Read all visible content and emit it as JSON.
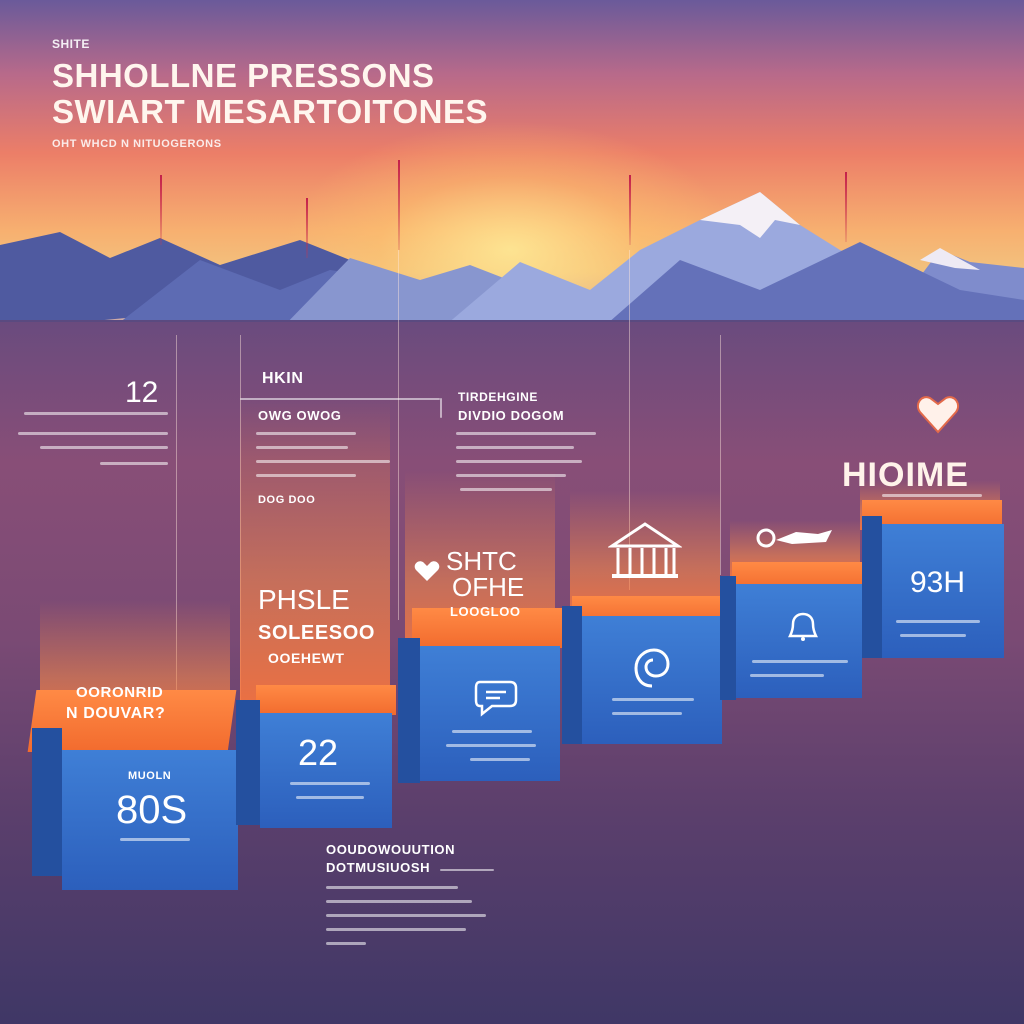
{
  "header": {
    "top_label": "SHITE",
    "title_line1": "SHHOLLNE PRESSONS",
    "title_line2": "SWIART MESARTOITONES",
    "tagline": "OHT WHCD N NITUOGERONS"
  },
  "columns": [
    {
      "id": "col1",
      "label": "12",
      "overlay_text": "OORONRID",
      "overlay_text2": "N DOUVAR?",
      "value_small": "MUOLN",
      "value": "80S"
    },
    {
      "id": "col2",
      "label": "HKIN",
      "heading": "OWG OWOG",
      "small": "DOG DOO",
      "card_line1": "PHSLE",
      "card_line2": "SOLEESOO",
      "card_line3": "OOEHEWT",
      "value": "22"
    },
    {
      "id": "col3",
      "heading1": "TIRDEHGINE",
      "heading2": "DIVDIO DOGOM",
      "card_line1": "SHTC",
      "card_line2": "OFHE",
      "card_line3": "LOOGLOO"
    },
    {
      "id": "col4"
    },
    {
      "id": "col5"
    },
    {
      "id": "col6",
      "head_word": "HIOIME",
      "value": "93H"
    }
  ],
  "footer": {
    "heading1": "OOUDOWOUUTION",
    "heading2": "DOTMUSIUOSH"
  },
  "icons": [
    "heart-icon",
    "building-icon",
    "spa-icon",
    "chat-icon",
    "spiral-icon",
    "bell-icon",
    "heart-small-icon"
  ]
}
